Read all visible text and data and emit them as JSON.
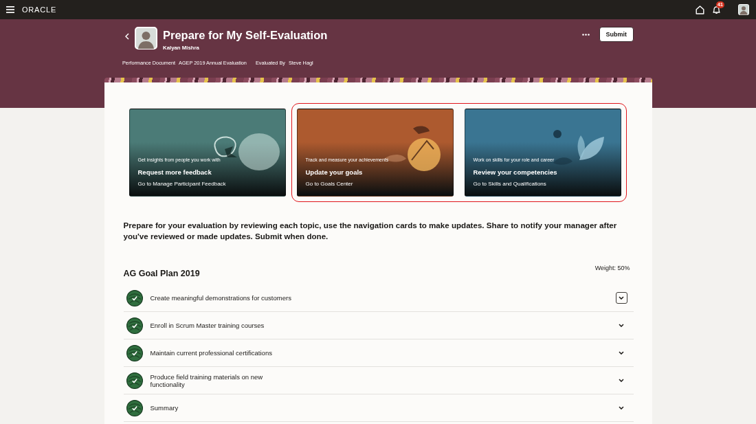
{
  "top_bar": {
    "brand": "ORACLE",
    "notifications_badge": "41"
  },
  "header": {
    "title": "Prepare for My Self-Evaluation",
    "subtitle": "Kalyan Mishra",
    "meta": [
      {
        "label": "Performance Document",
        "value": "AGEP 2019 Annual Evaluation"
      },
      {
        "label": "Evaluated By",
        "value": "Steve Hagl"
      }
    ],
    "submit": "Submit"
  },
  "navigation_card_groups": [
    {
      "highlighted": false,
      "cards": [
        {
          "caption": "Get insights from people you work with",
          "title": "Request more feedback",
          "link": "Go to Manage Participant Feedback",
          "color": "#4b7b77"
        }
      ]
    },
    {
      "highlighted": true,
      "cards": [
        {
          "caption": "Track and measure your achievements",
          "title": "Update your goals",
          "link": "Go to Goals Center",
          "color": "#ad5a2f"
        },
        {
          "caption": "Work on skills for your role and career",
          "title": "Review your competencies",
          "link": "Go to Skills and Qualifications",
          "color": "#3a7592"
        }
      ]
    }
  ],
  "instructions": "Prepare for your evaluation by reviewing each topic, use the navigation cards to make updates. Share to notify your manager after you've reviewed or made updates. Submit when done.",
  "goal_plan": {
    "title": "AG Goal Plan 2019",
    "weight": "Weight: 50%",
    "goals": [
      {
        "name": "Create meaningful demonstrations for customers",
        "focused": true
      },
      {
        "name": "Enroll in Scrum Master training courses",
        "focused": false
      },
      {
        "name": "Maintain current professional certifications",
        "focused": false
      },
      {
        "name": "Produce field training materials on new functionality",
        "focused": false
      },
      {
        "name": "Summary",
        "focused": false
      }
    ]
  }
}
